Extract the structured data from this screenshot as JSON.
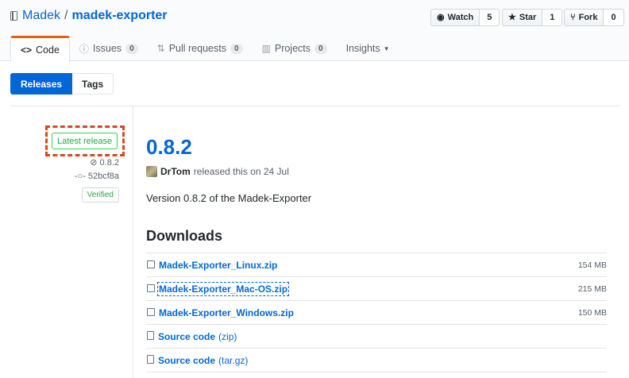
{
  "header": {
    "owner": "Madek",
    "separator": "/",
    "repo": "madek-exporter",
    "watch": {
      "label": "Watch",
      "count": "5"
    },
    "star": {
      "label": "Star",
      "count": "1"
    },
    "fork": {
      "label": "Fork",
      "count": "0"
    }
  },
  "tabs": [
    {
      "label": "Code",
      "icon": "code-icon"
    },
    {
      "label": "Issues",
      "count": "0",
      "icon": "issue-icon"
    },
    {
      "label": "Pull requests",
      "count": "0",
      "icon": "pull-request-icon"
    },
    {
      "label": "Projects",
      "count": "0",
      "icon": "project-icon"
    },
    {
      "label": "Insights",
      "icon": "caret-down-icon"
    }
  ],
  "subnav": {
    "releases": "Releases",
    "tags": "Tags"
  },
  "release": {
    "badge": "Latest release",
    "tag": "0.8.2",
    "commit": "52bcf8a",
    "verified": "Verified",
    "version": "0.8.2",
    "author": "DrTom",
    "released_text": "released this on 24 Jul",
    "description": "Version 0.8.2 of the Madek-Exporter",
    "downloads_heading": "Downloads",
    "assets": [
      {
        "name": "Madek-Exporter_Linux.zip",
        "size": "154 MB"
      },
      {
        "name": "Madek-Exporter_Mac-OS.zip",
        "size": "215 MB"
      },
      {
        "name": "Madek-Exporter_Windows.zip",
        "size": "150 MB"
      }
    ],
    "source": [
      {
        "name": "Source code",
        "kind": "(zip)"
      },
      {
        "name": "Source code",
        "kind": "(tar.gz)"
      }
    ]
  },
  "colors": {
    "accent": "#0366d6",
    "tab_highlight": "#e36209",
    "annotation": "#d9471c",
    "success": "#28a745"
  }
}
